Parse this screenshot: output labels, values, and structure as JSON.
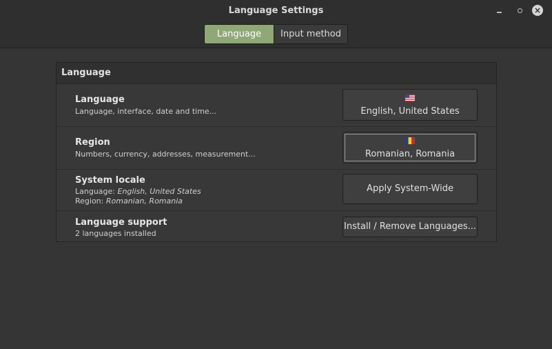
{
  "window": {
    "title": "Language Settings",
    "controls": {
      "minimize": "minimize-icon",
      "maximize": "maximize-icon",
      "close": "close-icon"
    }
  },
  "tabs": [
    {
      "label": "Language",
      "active": true
    },
    {
      "label": "Input method",
      "active": false
    }
  ],
  "section": {
    "header": "Language",
    "rows": {
      "language": {
        "title": "Language",
        "subtitle": "Language, interface, date and time...",
        "button_label": "English, United States",
        "flag": "us-flag-icon"
      },
      "region": {
        "title": "Region",
        "subtitle": "Numbers, currency, addresses, measurement...",
        "button_label": "Romanian, Romania",
        "flag": "ro-flag-icon"
      },
      "system_locale": {
        "title": "System locale",
        "language_prefix": "Language: ",
        "language_value": "English, United States",
        "region_prefix": "Region: ",
        "region_value": "Romanian, Romania",
        "button_label": "Apply System-Wide"
      },
      "language_support": {
        "title": "Language support",
        "subtitle": "2 languages installed",
        "button_label": "Install / Remove Languages..."
      }
    }
  },
  "colors": {
    "active_tab": "#8fa876",
    "background": "#353535",
    "titlebar": "#2f2f2f"
  }
}
